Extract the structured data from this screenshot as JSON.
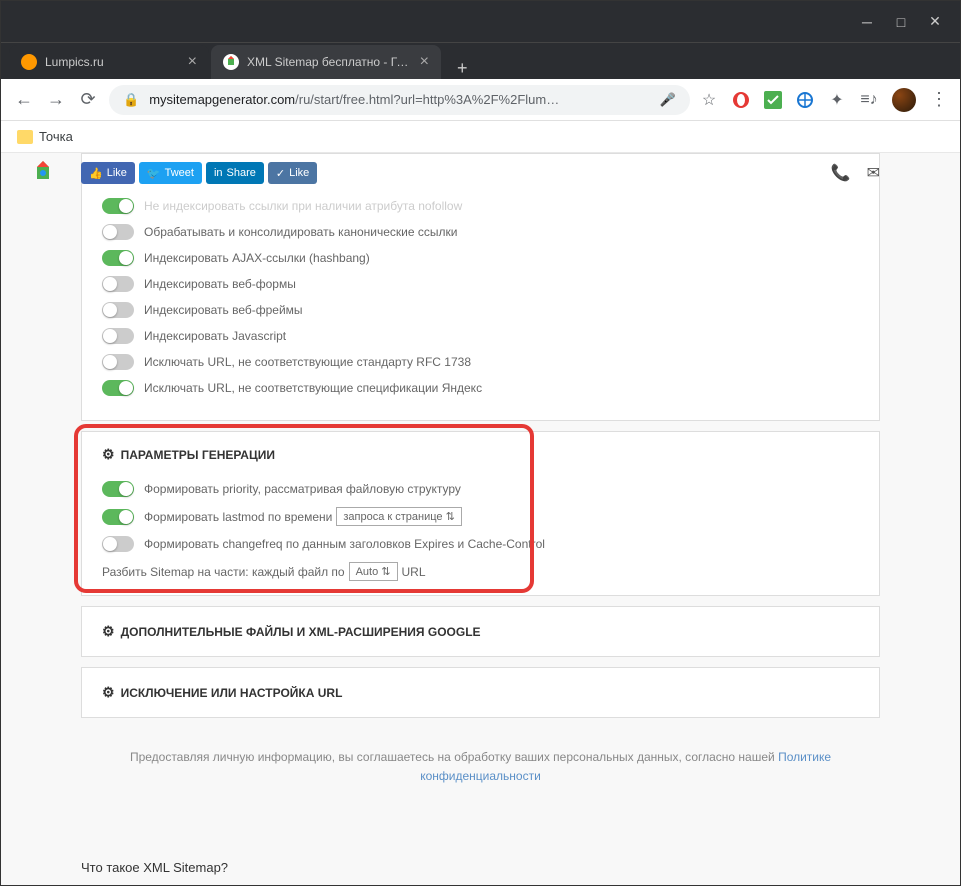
{
  "tabs": [
    {
      "title": "Lumpics.ru",
      "favicon_color": "#ff9800"
    },
    {
      "title": "XML Sitemap бесплатно - Генер",
      "favicon_color": "#fff"
    }
  ],
  "url": {
    "domain": "mysitemapgenerator.com",
    "path": "/ru/start/free.html?url=http%3A%2F%2Flum…"
  },
  "bookmarks": {
    "folder1": "Точка"
  },
  "social": {
    "fb": "Like",
    "tw": "Tweet",
    "li": "Share",
    "vk": "Like"
  },
  "settings1": {
    "row0": "Не индексировать ссылки при наличии атрибута nofollow",
    "row1": "Обрабатывать и консолидировать канонические ссылки",
    "row2": "Индексировать AJAX-ссылки (hashbang)",
    "row3": "Индексировать веб-формы",
    "row4": "Индексировать веб-фреймы",
    "row5": "Индексировать Javascript",
    "row6": "Исключать URL, не соответствующие стандарту RFC 1738",
    "row7": "Исключать URL, не соответствующие спецификации Яндекс"
  },
  "gen_params": {
    "header": "ПАРАМЕТРЫ ГЕНЕРАЦИИ",
    "row1": "Формировать priority, рассматривая файловую структуру",
    "row2_pre": "Формировать lastmod по времени",
    "row2_select": "запроса к странице",
    "row3": "Формировать changefreq по данным заголовков Expires и Cache-Control",
    "split_pre": "Разбить Sitemap на части: каждый файл по",
    "split_select": "Auto",
    "split_post": "URL"
  },
  "collapsed1": "ДОПОЛНИТЕЛЬНЫЕ ФАЙЛЫ И XML-РАСШИРЕНИЯ GOOGLE",
  "collapsed2": "ИСКЛЮЧЕНИЕ ИЛИ НАСТРОЙКА URL",
  "disclaimer": {
    "text": "Предоставляя личную информацию, вы соглашаетесь на обработку ваших персональных данных, согласно нашей ",
    "link": "Политике конфиденциальности"
  },
  "footer_q": "Что такое XML Sitemap?"
}
